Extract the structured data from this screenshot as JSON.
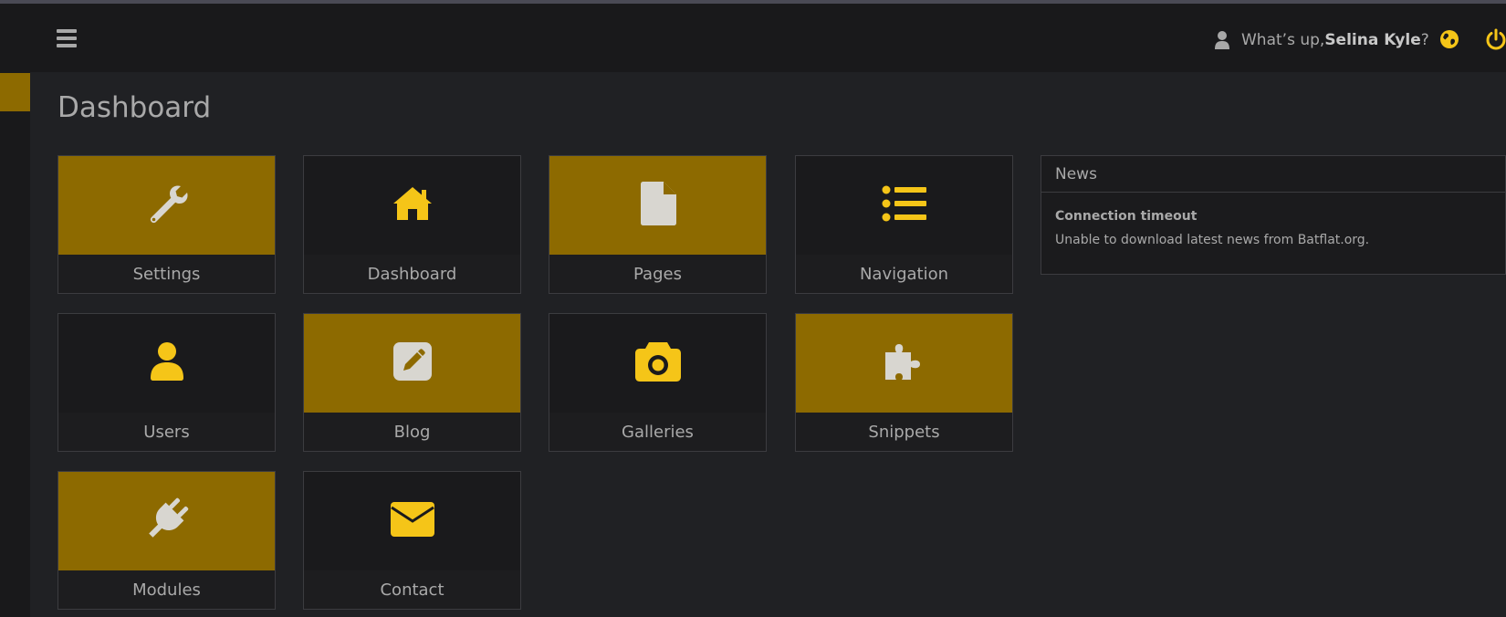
{
  "header": {
    "greeting_prefix": "What’s up, ",
    "user_name": "Selina Kyle",
    "greeting_suffix": "?",
    "icons": [
      "menu-icon",
      "user-icon",
      "globe-icon",
      "power-icon"
    ]
  },
  "page": {
    "title": "Dashboard"
  },
  "tiles": [
    {
      "label": "Settings",
      "icon": "wrench-icon",
      "style": "gold"
    },
    {
      "label": "Dashboard",
      "icon": "home-icon",
      "style": "dark"
    },
    {
      "label": "Pages",
      "icon": "file-icon",
      "style": "gold"
    },
    {
      "label": "Navigation",
      "icon": "list-icon",
      "style": "dark"
    },
    {
      "label": "Users",
      "icon": "user-icon",
      "style": "dark"
    },
    {
      "label": "Blog",
      "icon": "edit-icon",
      "style": "gold"
    },
    {
      "label": "Galleries",
      "icon": "camera-icon",
      "style": "dark"
    },
    {
      "label": "Snippets",
      "icon": "puzzle-icon",
      "style": "gold"
    },
    {
      "label": "Modules",
      "icon": "plug-icon",
      "style": "gold"
    },
    {
      "label": "Contact",
      "icon": "envelope-icon",
      "style": "dark"
    }
  ],
  "news": {
    "heading": "News",
    "item_title": "Connection timeout",
    "item_text": "Unable to download latest news from Batflat.org."
  },
  "colors": {
    "accent_gold": "#8d6a00",
    "icon_yellow": "#f5c518",
    "icon_light": "#d8d6d0",
    "background": "#202124",
    "navbar": "#19191b"
  }
}
